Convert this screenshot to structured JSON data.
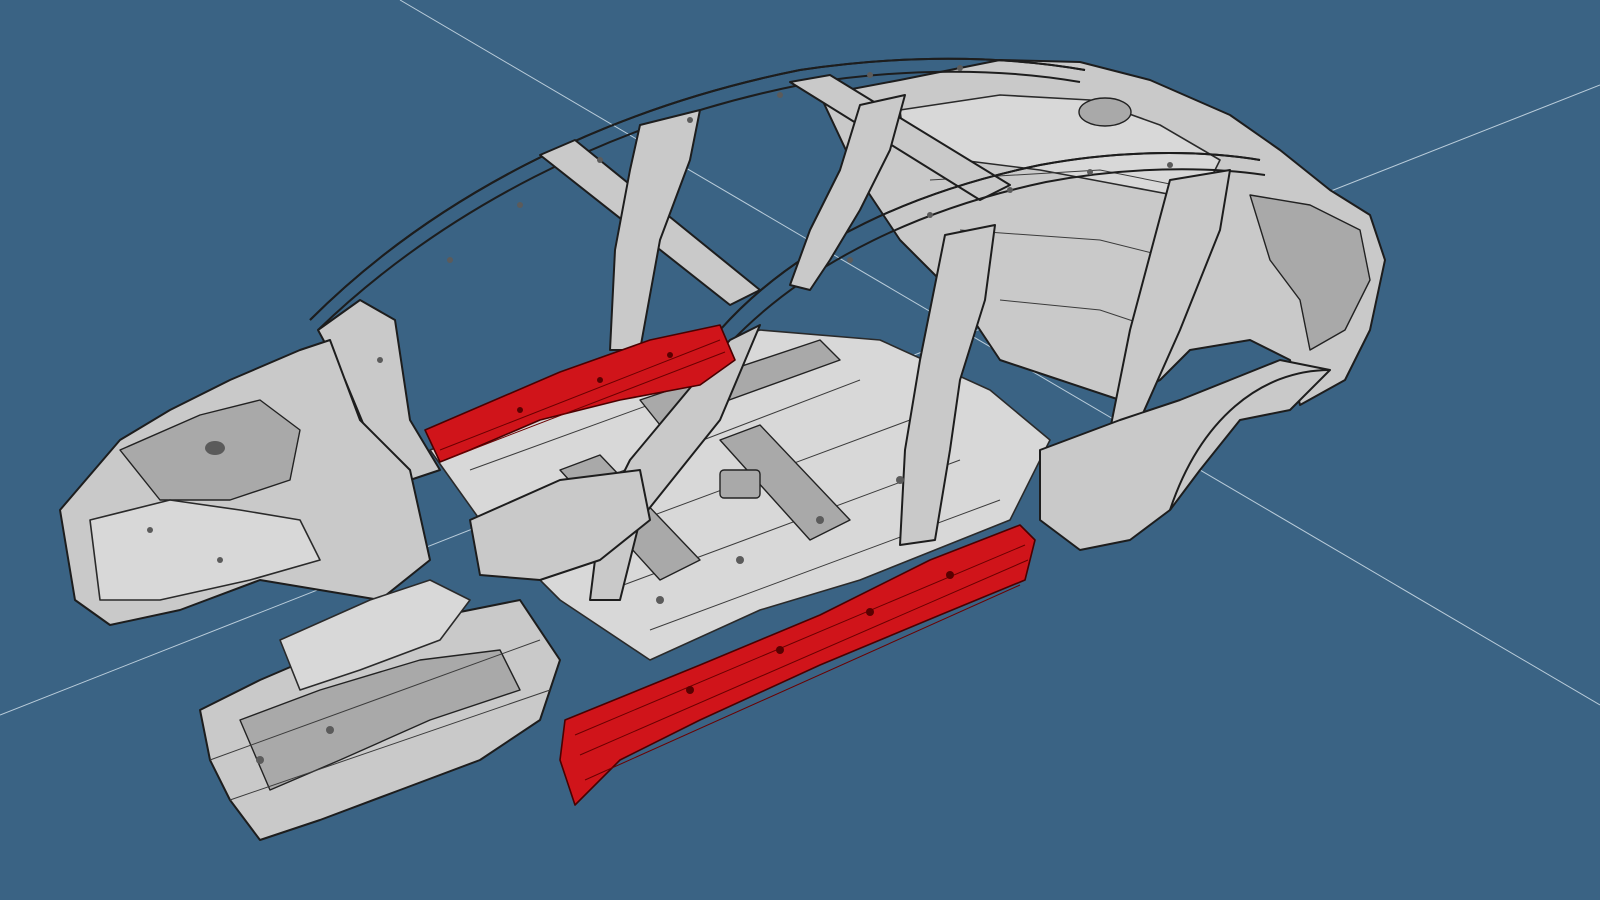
{
  "scene": {
    "background": "#3a6384",
    "axis_color": "#b9ccda",
    "body_color": "#c9c9c9",
    "outline_color": "#1d1d1d",
    "highlight_color": "#d0141a",
    "highlighted_parts": [
      "rocker-panel-left",
      "rocker-panel-right"
    ]
  }
}
